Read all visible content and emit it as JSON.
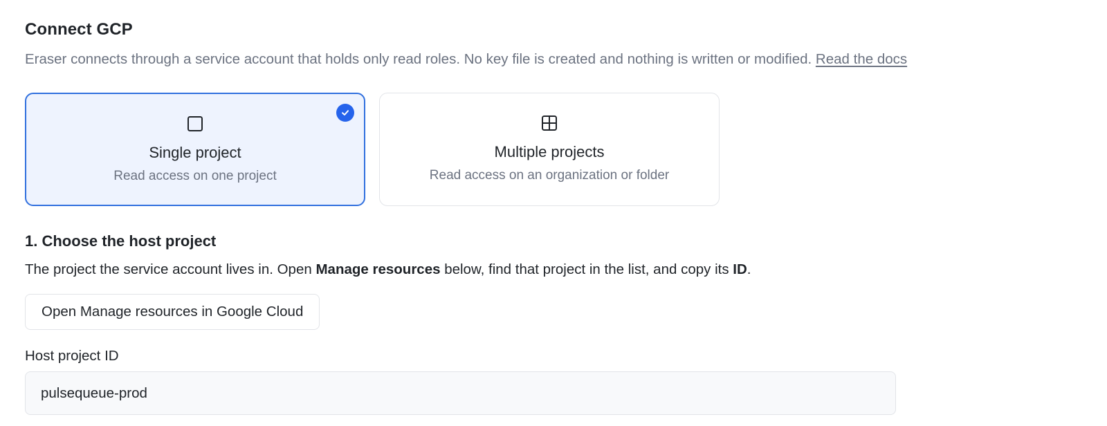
{
  "header": {
    "title": "Connect GCP",
    "subtitle": "Eraser connects through a service account that holds only read roles. No key file is created and nothing is written or modified.",
    "docs_link": "Read the docs"
  },
  "scope_options": [
    {
      "title": "Single project",
      "description": "Read access on one project",
      "icon": "square-icon",
      "selected": true
    },
    {
      "title": "Multiple projects",
      "description": "Read access on an organization or folder",
      "icon": "grid-icon",
      "selected": false
    }
  ],
  "step1": {
    "title": "1. Choose the host project",
    "desc_part1": "The project the service account lives in. Open ",
    "desc_bold1": "Manage resources",
    "desc_part2": " below, find that project in the list, and copy its ",
    "desc_bold2": "ID",
    "desc_part3": ".",
    "button_label": "Open Manage resources in Google Cloud"
  },
  "host_project": {
    "label": "Host project ID",
    "value": "pulsequeue-prod"
  },
  "colors": {
    "accent": "#2563eb",
    "selected_bg": "#eef3fe",
    "muted_text": "#6b7280"
  }
}
